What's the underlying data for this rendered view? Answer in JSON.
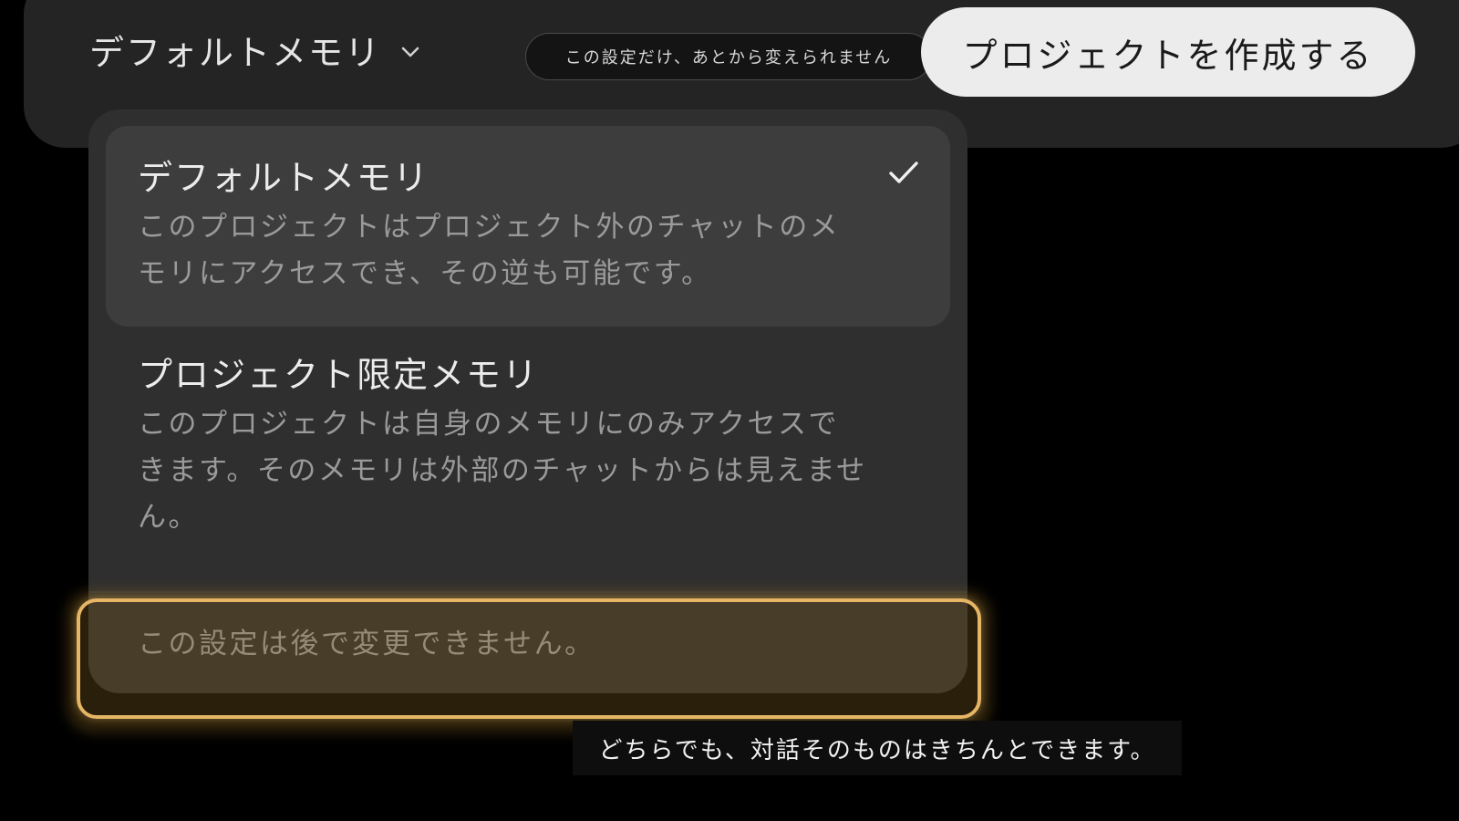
{
  "header": {
    "memory_select_label": "デフォルトメモリ",
    "warning_pill": "この設定だけ、あとから変えられません",
    "create_button": "プロジェクトを作成する"
  },
  "dropdown": {
    "options": [
      {
        "title": "デフォルトメモリ",
        "description": "このプロジェクトはプロジェクト外のチャットのメモリにアクセスでき、その逆も可能です。",
        "selected": true
      },
      {
        "title": "プロジェクト限定メモリ",
        "description": "このプロジェクトは自身のメモリにのみアクセスできます。そのメモリは外部のチャットからは見えません。",
        "selected": false
      }
    ],
    "note": "この設定は後で変更できません。"
  },
  "caption": "どちらでも、対話そのものはきちんとできます。",
  "colors": {
    "background": "#000000",
    "panel": "#242424",
    "dropdown": "#2f2f2f",
    "selected_option": "#3d3d3d",
    "highlight": "#e6b566",
    "button": "#ececec"
  },
  "icons": {
    "chevron": "chevron-down-icon",
    "check": "check-icon"
  }
}
